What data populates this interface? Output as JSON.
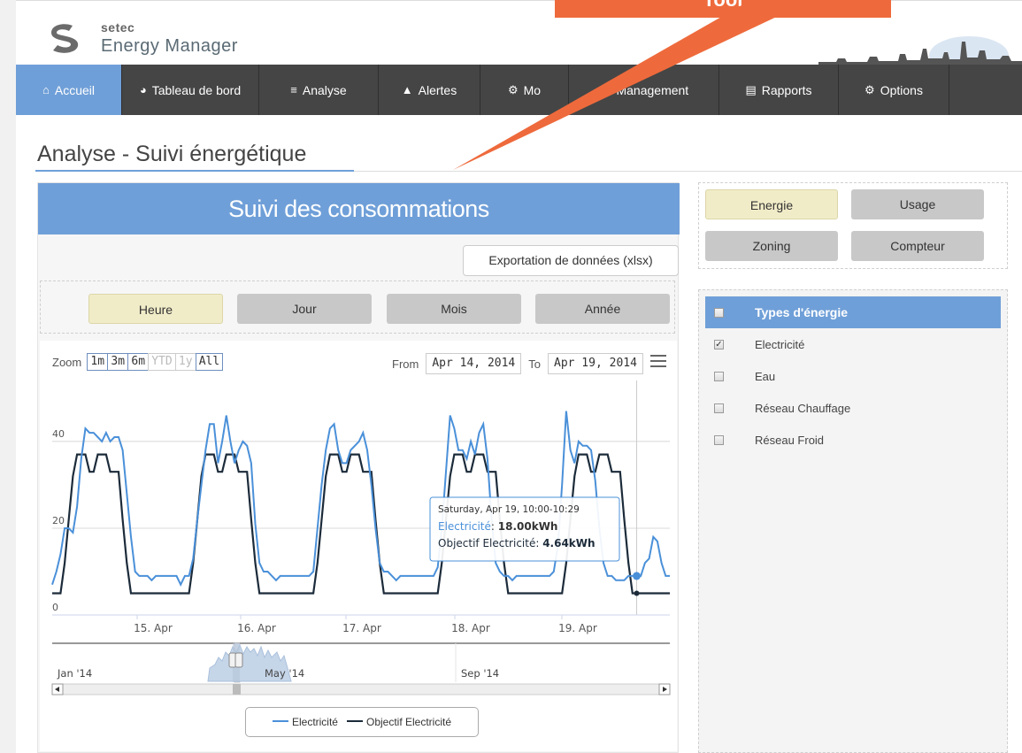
{
  "callout": {
    "text": "Tool"
  },
  "brand": {
    "company": "setec",
    "product": "Energy Manager"
  },
  "nav": [
    {
      "label": "Accueil",
      "icon": "home-icon",
      "glyph": "⌂",
      "active": true
    },
    {
      "label": "Tableau de bord",
      "icon": "dashboard-icon",
      "glyph": "◕"
    },
    {
      "label": "Analyse",
      "icon": "bar-chart-icon",
      "glyph": "≡"
    },
    {
      "label": "Alertes",
      "icon": "warning-icon",
      "glyph": "▲"
    },
    {
      "label": "Mo",
      "icon": "cogs-icon",
      "glyph": "⚙"
    },
    {
      "label": "Management",
      "icon": "users-icon",
      "glyph": "☻"
    },
    {
      "label": "Rapports",
      "icon": "document-icon",
      "glyph": "▤"
    },
    {
      "label": "Options",
      "icon": "gear-icon",
      "glyph": "⚙"
    }
  ],
  "page": {
    "title": "Analyse - Suivi énergétique"
  },
  "panel": {
    "title": "Suivi des consommations",
    "export_label": "Exportation de données (xlsx)",
    "periods": [
      {
        "label": "Heure",
        "active": true
      },
      {
        "label": "Jour"
      },
      {
        "label": "Mois"
      },
      {
        "label": "Année"
      }
    ]
  },
  "chart_controls": {
    "zoom_label": "Zoom",
    "zoom_buttons": [
      {
        "label": "1m"
      },
      {
        "label": "3m"
      },
      {
        "label": "6m"
      },
      {
        "label": "YTD",
        "disabled": true
      },
      {
        "label": "1y",
        "disabled": true
      },
      {
        "label": "All"
      }
    ],
    "from_label": "From",
    "from_value": "Apr 14, 2014",
    "to_label": "To",
    "to_value": "Apr 19, 2014"
  },
  "chart_data": {
    "type": "line",
    "y_ticks": [
      "0",
      "20",
      "40"
    ],
    "ylim": [
      0,
      51
    ],
    "x_ticks": [
      "15. Apr",
      "16. Apr",
      "17. Apr",
      "18. Apr",
      "19. Apr"
    ],
    "navigator_ticks": [
      "Jan '14",
      "May '14",
      "Sep '14"
    ],
    "series": [
      {
        "name": "Electricité",
        "color": "#4a90d9",
        "values": [
          7,
          10,
          14,
          20,
          20,
          19,
          25,
          36,
          43,
          42,
          42,
          41,
          40,
          42,
          40,
          41,
          41,
          38,
          28,
          18,
          10,
          9,
          9,
          9,
          8,
          9,
          9,
          9,
          9,
          9,
          9,
          7,
          9,
          9,
          13,
          22,
          30,
          38,
          44,
          44,
          35,
          40,
          46,
          40,
          35,
          38,
          40,
          39,
          35,
          21,
          12,
          10,
          10,
          9,
          8,
          9,
          9,
          9,
          9,
          9,
          9,
          9,
          9,
          10,
          20,
          30,
          38,
          43,
          44,
          38,
          35,
          35,
          38,
          39,
          40,
          42,
          38,
          30,
          20,
          12,
          10,
          10,
          9,
          8,
          9,
          9,
          9,
          9,
          9,
          9,
          9,
          9,
          9,
          11,
          20,
          33,
          46,
          43,
          38,
          38,
          36,
          40,
          37,
          42,
          44,
          36,
          22,
          12,
          10,
          9,
          9,
          8,
          9,
          9,
          9,
          9,
          9,
          9,
          9,
          9,
          9,
          10,
          16,
          30,
          47,
          38,
          35,
          40,
          39,
          39,
          38,
          31,
          20,
          12,
          9,
          9,
          8,
          8,
          8,
          9,
          9,
          9,
          9,
          12,
          13,
          18,
          17,
          12,
          9,
          9
        ]
      },
      {
        "name": "Objectif Electricité",
        "color": "#1c2b3a",
        "values": [
          5,
          5,
          5,
          12,
          22,
          32,
          37,
          37,
          37,
          33,
          33,
          37,
          37,
          37,
          33,
          33,
          33,
          22,
          12,
          5,
          5,
          5,
          5,
          5,
          5,
          5,
          5,
          5,
          5,
          5,
          5,
          5,
          5,
          5,
          12,
          22,
          32,
          37,
          37,
          37,
          33,
          33,
          37,
          37,
          37,
          33,
          33,
          33,
          22,
          12,
          5,
          5,
          5,
          5,
          5,
          5,
          5,
          5,
          5,
          5,
          5,
          5,
          5,
          5,
          12,
          22,
          32,
          37,
          37,
          37,
          33,
          33,
          37,
          37,
          37,
          33,
          33,
          33,
          22,
          12,
          5,
          5,
          5,
          5,
          5,
          5,
          5,
          5,
          5,
          5,
          5,
          5,
          5,
          5,
          12,
          22,
          32,
          37,
          37,
          37,
          33,
          33,
          37,
          37,
          37,
          33,
          33,
          33,
          22,
          12,
          5,
          5,
          5,
          5,
          5,
          5,
          5,
          5,
          5,
          5,
          5,
          5,
          5,
          5,
          12,
          22,
          32,
          37,
          37,
          37,
          33,
          33,
          37,
          37,
          37,
          33,
          33,
          33,
          22,
          12,
          5,
          5,
          5,
          5,
          5,
          5,
          5,
          5,
          5,
          5
        ]
      }
    ],
    "tooltip": {
      "title": "Saturday, Apr 19, 10:00-10:29",
      "line1_name": "Electricité",
      "line1_value": "18.00kWh",
      "line2_name": "Objectif Electricité",
      "line2_value": "4.64kWh"
    }
  },
  "side_filters": [
    {
      "label": "Energie",
      "active": true
    },
    {
      "label": "Usage"
    },
    {
      "label": "Zoning"
    },
    {
      "label": "Compteur"
    }
  ],
  "energy_types": {
    "header": "Types d'énergie",
    "items": [
      {
        "label": "Electricité",
        "checked": true
      },
      {
        "label": "Eau",
        "checked": false
      },
      {
        "label": "Réseau Chauffage",
        "checked": false
      },
      {
        "label": "Réseau Froid",
        "checked": false
      }
    ]
  }
}
